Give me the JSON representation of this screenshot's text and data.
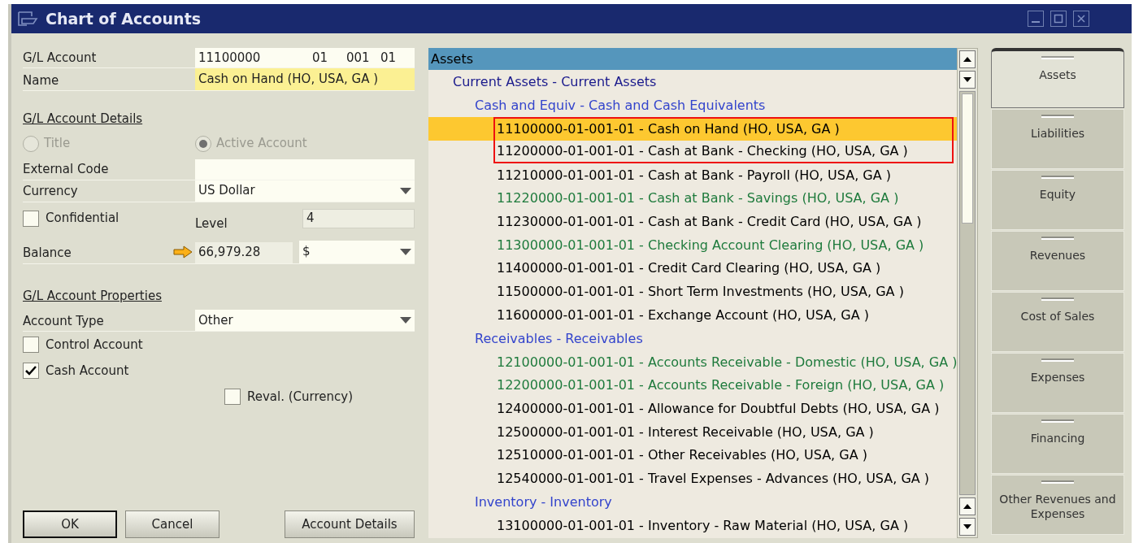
{
  "window": {
    "title": "Chart of Accounts"
  },
  "form": {
    "gl_account": {
      "label": "G/L Account",
      "value": "11100000",
      "segments": [
        "01",
        "001",
        "01"
      ]
    },
    "name": {
      "label": "Name",
      "value": "Cash on Hand (HO, USA, GA )"
    },
    "details_heading": "G/L Account Details",
    "radios": [
      {
        "label": "Title",
        "selected": false,
        "disabled": true
      },
      {
        "label": "Active Account",
        "selected": true,
        "disabled": true
      }
    ],
    "external_code": {
      "label": "External Code"
    },
    "currency": {
      "label": "Currency",
      "value": "US Dollar"
    },
    "confidential": {
      "label": "Confidential",
      "checked": false
    },
    "level": {
      "label": "Level",
      "value": "4"
    },
    "balance": {
      "label": "Balance",
      "value": "66,979.28",
      "currency": "$"
    },
    "properties_heading": "G/L Account Properties",
    "account_type": {
      "label": "Account Type",
      "value": "Other"
    },
    "checkboxes": [
      {
        "label": "Control Account",
        "checked": false
      },
      {
        "label": "Cash Account",
        "checked": true
      }
    ],
    "reval": {
      "label": "Reval. (Currency)",
      "checked": false
    }
  },
  "buttons": [
    {
      "label": "OK",
      "default": true
    },
    {
      "label": "Cancel",
      "default": false
    }
  ],
  "details_button": "Account Details",
  "tree": {
    "label": "Assets",
    "children": [
      {
        "label": "Current Assets - Current Assets",
        "color": "#1a1a8c",
        "children": [
          {
            "label": "Cash and Equiv - Cash and Cash Equivalents",
            "color": "#3344cc",
            "children": [
              {
                "label": "11100000-01-001-01 - Cash on Hand (HO, USA, GA )",
                "color": "#000000",
                "selected": true,
                "boxed": true
              },
              {
                "label": "11200000-01-001-01 - Cash at Bank - Checking (HO, USA, GA )",
                "color": "#000000",
                "selected": false,
                "boxed": true
              },
              {
                "label": "11210000-01-001-01 - Cash at Bank - Payroll (HO, USA, GA )",
                "color": "#000000",
                "selected": false,
                "boxed": false
              },
              {
                "label": "11220000-01-001-01 - Cash at Bank - Savings (HO, USA, GA )",
                "color": "#1e7a3c",
                "selected": false,
                "boxed": false
              },
              {
                "label": "11230000-01-001-01 - Cash at Bank - Credit Card (HO, USA, GA )",
                "color": "#000000",
                "selected": false,
                "boxed": false
              },
              {
                "label": "11300000-01-001-01 - Checking Account Clearing (HO, USA, GA )",
                "color": "#1e7a3c",
                "selected": false,
                "boxed": false
              },
              {
                "label": "11400000-01-001-01 - Credit Card Clearing (HO, USA, GA )",
                "color": "#000000",
                "selected": false,
                "boxed": false
              },
              {
                "label": "11500000-01-001-01 - Short Term Investments (HO, USA, GA )",
                "color": "#000000",
                "selected": false,
                "boxed": false
              },
              {
                "label": "11600000-01-001-01 - Exchange Account (HO, USA, GA )",
                "color": "#000000",
                "selected": false,
                "boxed": false
              }
            ]
          },
          {
            "label": "Receivables - Receivables",
            "color": "#3344cc",
            "children": [
              {
                "label": "12100000-01-001-01 - Accounts Receivable - Domestic (HO, USA, GA )",
                "color": "#1e7a3c",
                "selected": false,
                "boxed": false
              },
              {
                "label": "12200000-01-001-01 - Accounts Receivable - Foreign (HO, USA, GA )",
                "color": "#1e7a3c",
                "selected": false,
                "boxed": false
              },
              {
                "label": "12400000-01-001-01 - Allowance for Doubtful Debts (HO, USA, GA )",
                "color": "#000000",
                "selected": false,
                "boxed": false
              },
              {
                "label": "12500000-01-001-01 - Interest Receivable (HO, USA, GA )",
                "color": "#000000",
                "selected": false,
                "boxed": false
              },
              {
                "label": "12510000-01-001-01 - Other Receivables (HO, USA, GA )",
                "color": "#000000",
                "selected": false,
                "boxed": false
              },
              {
                "label": "12540000-01-001-01 - Travel Expenses - Advances (HO, USA, GA )",
                "color": "#000000",
                "selected": false,
                "boxed": false
              }
            ]
          },
          {
            "label": "Inventory - Inventory",
            "color": "#3344cc",
            "children": [
              {
                "label": "13100000-01-001-01 - Inventory - Raw Material (HO, USA, GA )",
                "color": "#000000",
                "selected": false,
                "boxed": false
              }
            ]
          }
        ]
      }
    ]
  },
  "categories": [
    {
      "label": "Assets",
      "selected": true
    },
    {
      "label": "Liabilities",
      "selected": false
    },
    {
      "label": "Equity",
      "selected": false
    },
    {
      "label": "Revenues",
      "selected": false
    },
    {
      "label": "Cost of Sales",
      "selected": false
    },
    {
      "label": "Expenses",
      "selected": false
    },
    {
      "label": "Financing",
      "selected": false
    },
    {
      "label": "Other Revenues and Expenses",
      "selected": false
    }
  ]
}
